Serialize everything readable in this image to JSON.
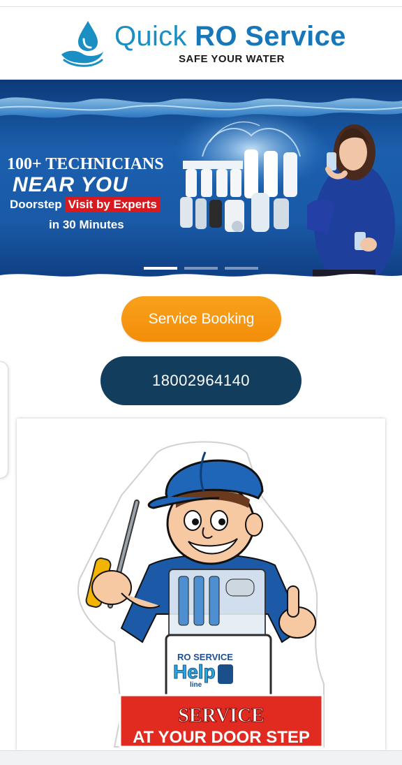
{
  "header": {
    "logo_title_light": "Quick ",
    "logo_title_bold": "RO Service",
    "logo_tagline": "SAFE YOUR WATER"
  },
  "banner": {
    "headline": "100+ TECHNICIANS",
    "subheadline": "NEAR YOU",
    "doorstep_prefix": "Doorstep",
    "doorstep_highlight": "Visit by Experts",
    "time_line": "in 30 Minutes",
    "slides": 3,
    "active_slide": 1
  },
  "actions": {
    "booking_label": "Service Booking",
    "phone_label": "18002964140"
  },
  "mascot_card": {
    "badge_brand_top": "RO SERVICE",
    "badge_brand_main": "Help",
    "badge_brand_sub": "line",
    "banner_line1": "SERVICE",
    "banner_line2": "AT YOUR DOOR STEP"
  },
  "colors": {
    "brand_blue": "#1877b8",
    "booking_orange": "#f59a12",
    "phone_navy": "#133d5d",
    "highlight_red": "#d71920"
  }
}
